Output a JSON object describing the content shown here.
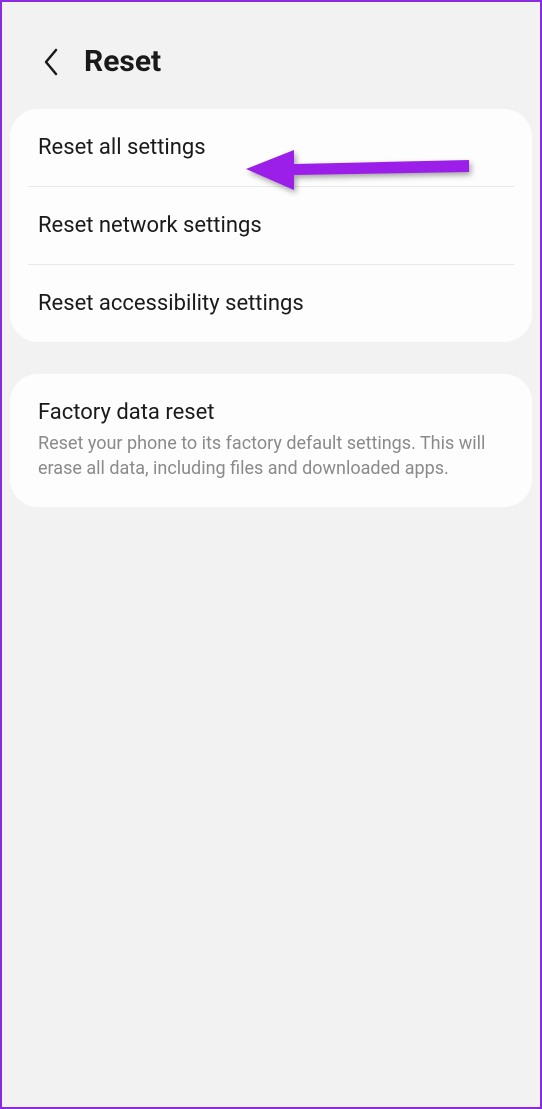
{
  "header": {
    "title": "Reset"
  },
  "group1": {
    "items": [
      {
        "label": "Reset all settings"
      },
      {
        "label": "Reset network settings"
      },
      {
        "label": "Reset accessibility settings"
      }
    ]
  },
  "group2": {
    "item": {
      "label": "Factory data reset",
      "description": "Reset your phone to its factory default settings. This will erase all data, including files and downloaded apps."
    }
  },
  "annotation": {
    "arrow_color": "#9b1fe8"
  }
}
